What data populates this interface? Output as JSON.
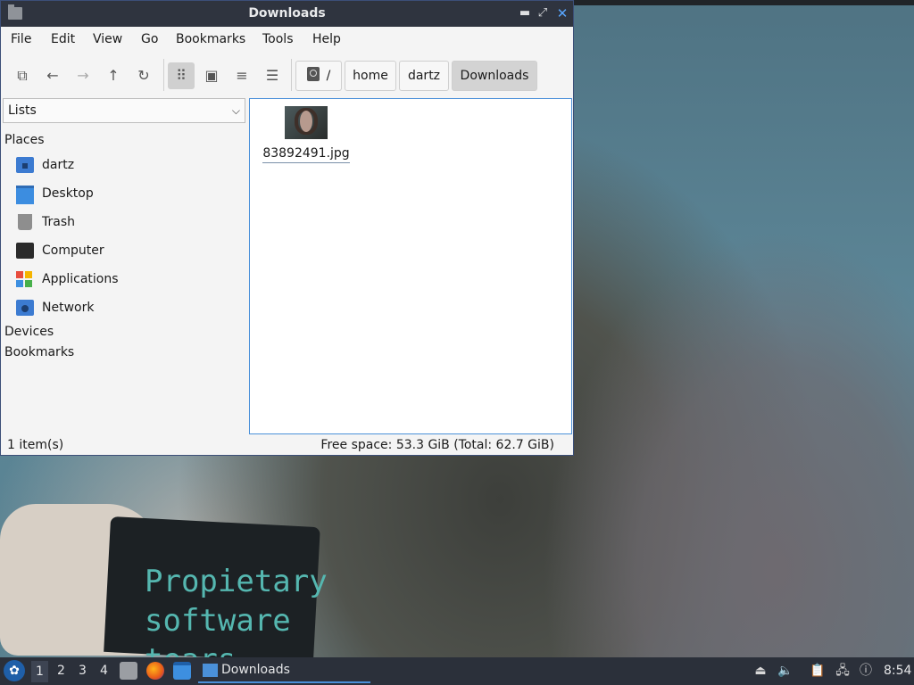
{
  "window": {
    "title": "Downloads",
    "controls": {
      "minimize": "▬",
      "maximize": "⤢",
      "close": "✕"
    }
  },
  "menu": [
    "File",
    "Edit",
    "View",
    "Go",
    "Bookmarks",
    "Tools",
    "Help"
  ],
  "toolbar": {
    "icons": [
      "new-tab-icon",
      "back-icon",
      "forward-icon",
      "up-icon",
      "reload-icon",
      "icon-view-icon",
      "thumbnail-view-icon",
      "compact-view-icon",
      "detailed-list-view-icon"
    ],
    "breadcrumbs": [
      "/",
      "home",
      "dartz",
      "Downloads"
    ]
  },
  "sidebar": {
    "combo_value": "Lists",
    "sections": {
      "places": "Places",
      "devices": "Devices",
      "bookmarks": "Bookmarks"
    },
    "places_items": [
      {
        "label": "dartz",
        "icon": "home-folder-icon"
      },
      {
        "label": "Desktop",
        "icon": "desktop-icon"
      },
      {
        "label": "Trash",
        "icon": "trash-icon"
      },
      {
        "label": "Computer",
        "icon": "computer-icon"
      },
      {
        "label": "Applications",
        "icon": "applications-icon"
      },
      {
        "label": "Network",
        "icon": "network-icon"
      }
    ]
  },
  "files": [
    {
      "name": "83892491.jpg",
      "icon": "image-thumbnail"
    }
  ],
  "status": {
    "count": "1 item(s)",
    "free_space": "Free space: 53.3 GiB (Total: 62.7 GiB)"
  },
  "wallpaper": {
    "mug_text": "Propietary\nsoftware\ntears"
  },
  "taskbar": {
    "workspaces": [
      "1",
      "2",
      "3",
      "4"
    ],
    "task_label": "Downloads",
    "clock": "8:54"
  }
}
